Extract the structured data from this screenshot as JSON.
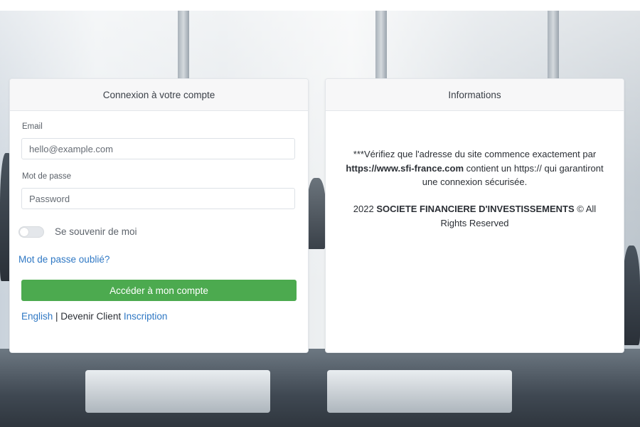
{
  "login": {
    "title": "Connexion à votre compte",
    "email_label": "Email",
    "email_placeholder": "hello@example.com",
    "password_label": "Mot de passe",
    "password_placeholder": "Password",
    "remember_label": "Se souvenir de moi",
    "remember_checked": false,
    "forgot_label": "Mot de passe oublié?",
    "submit_label": "Accéder à mon compte",
    "footer": {
      "language_link": "English",
      "separator": " | Devenir Client ",
      "signup_link": "Inscription"
    }
  },
  "info": {
    "title": "Informations",
    "warning_prefix": "***Vérifiez que l'adresse du site commence exactement par ",
    "warning_url": "https://www.sfi-france.com",
    "warning_suffix": " contient un https:// qui garantiront une connexion sécurisée.",
    "copyright_year": "2022 ",
    "company_name": "SOCIETE FINANCIERE D'INVESTISSEMENTS",
    "copyright_suffix": " © All Rights Reserved"
  },
  "colors": {
    "primary_button": "#4caa4f",
    "link": "#2f78c4",
    "header_bg": "#f7f7f8"
  },
  "icons": {}
}
